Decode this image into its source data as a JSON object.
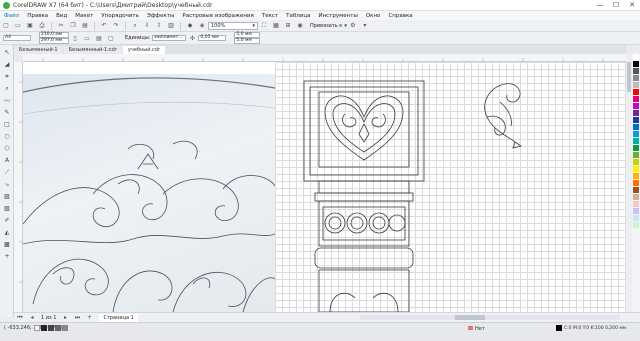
{
  "window": {
    "title": "CorelDRAW X7 (64 бит) - C:\\Users\\Дмитрий\\Desktop\\учебный.cdr",
    "minimize": "—",
    "maximize": "☐",
    "close": "✕"
  },
  "menu": [
    "Файл",
    "Правка",
    "Вид",
    "Макет",
    "Упорядочить",
    "Эффекты",
    "Растровые изображения",
    "Текст",
    "Таблица",
    "Инструменты",
    "Окно",
    "Справка"
  ],
  "toolbar": {
    "zoom": "100%",
    "snap_label": "Привязать к"
  },
  "property_bar": {
    "page_size": "A4",
    "width": "210,0 мм",
    "height": "297,0 мм",
    "units_label": "Единицы:",
    "units": "миллимет...",
    "nudge": "0,05 мм",
    "dup_x": "5,0 мм",
    "dup_y": "5,0 мм"
  },
  "tabs": [
    "Безымянный-1",
    "Безымянный-1:cdr",
    "учебный.cdr"
  ],
  "active_tab": 2,
  "page_nav": {
    "counter": "1 из 1",
    "page_tab": "Страница 1"
  },
  "status": {
    "coords": "( -633,246; 2 050,272 )",
    "fill_label": "Нет",
    "outline_info": "C:0 M:0 Y:0 K:100  0,200 мм"
  },
  "palette_colors": [
    "#ffffff",
    "#000000",
    "#555555",
    "#888888",
    "#bbbbbb",
    "#ff0000",
    "#e2007a",
    "#cc00cc",
    "#6a2c91",
    "#1f3c99",
    "#0070c0",
    "#00a0e0",
    "#00b0a0",
    "#00a040",
    "#70b030",
    "#c8d400",
    "#ffee00",
    "#ffb000",
    "#ff7000",
    "#a05020",
    "#d8b090",
    "#f4c6c6",
    "#c6c6f4",
    "#c6e6f4",
    "#d0f0d0"
  ],
  "colors": {
    "accent": "#0b6ec5",
    "grid_line": "#dcdcdc",
    "drawing_stroke": "#3a3a3a"
  }
}
